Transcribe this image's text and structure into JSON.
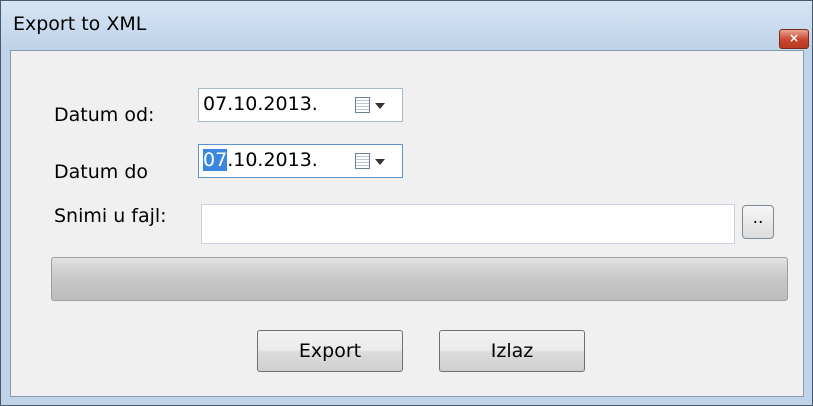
{
  "window": {
    "title": "Export to XML",
    "close_glyph": "×"
  },
  "form": {
    "date_from_label": "Datum od:",
    "date_from_value": "07.10.2013.",
    "date_to_label": "Datum do",
    "date_to_selected": "07",
    "date_to_rest": ".10.2013.",
    "save_file_label": "Snimi u fajl:",
    "save_file_value": "",
    "browse_label": ".."
  },
  "progress": {
    "value": 0
  },
  "buttons": {
    "export_label": "Export",
    "exit_label": "Izlaz"
  },
  "icons": {
    "calendar": "calendar-icon",
    "dropdown": "chevron-down-icon",
    "close": "close-icon"
  }
}
